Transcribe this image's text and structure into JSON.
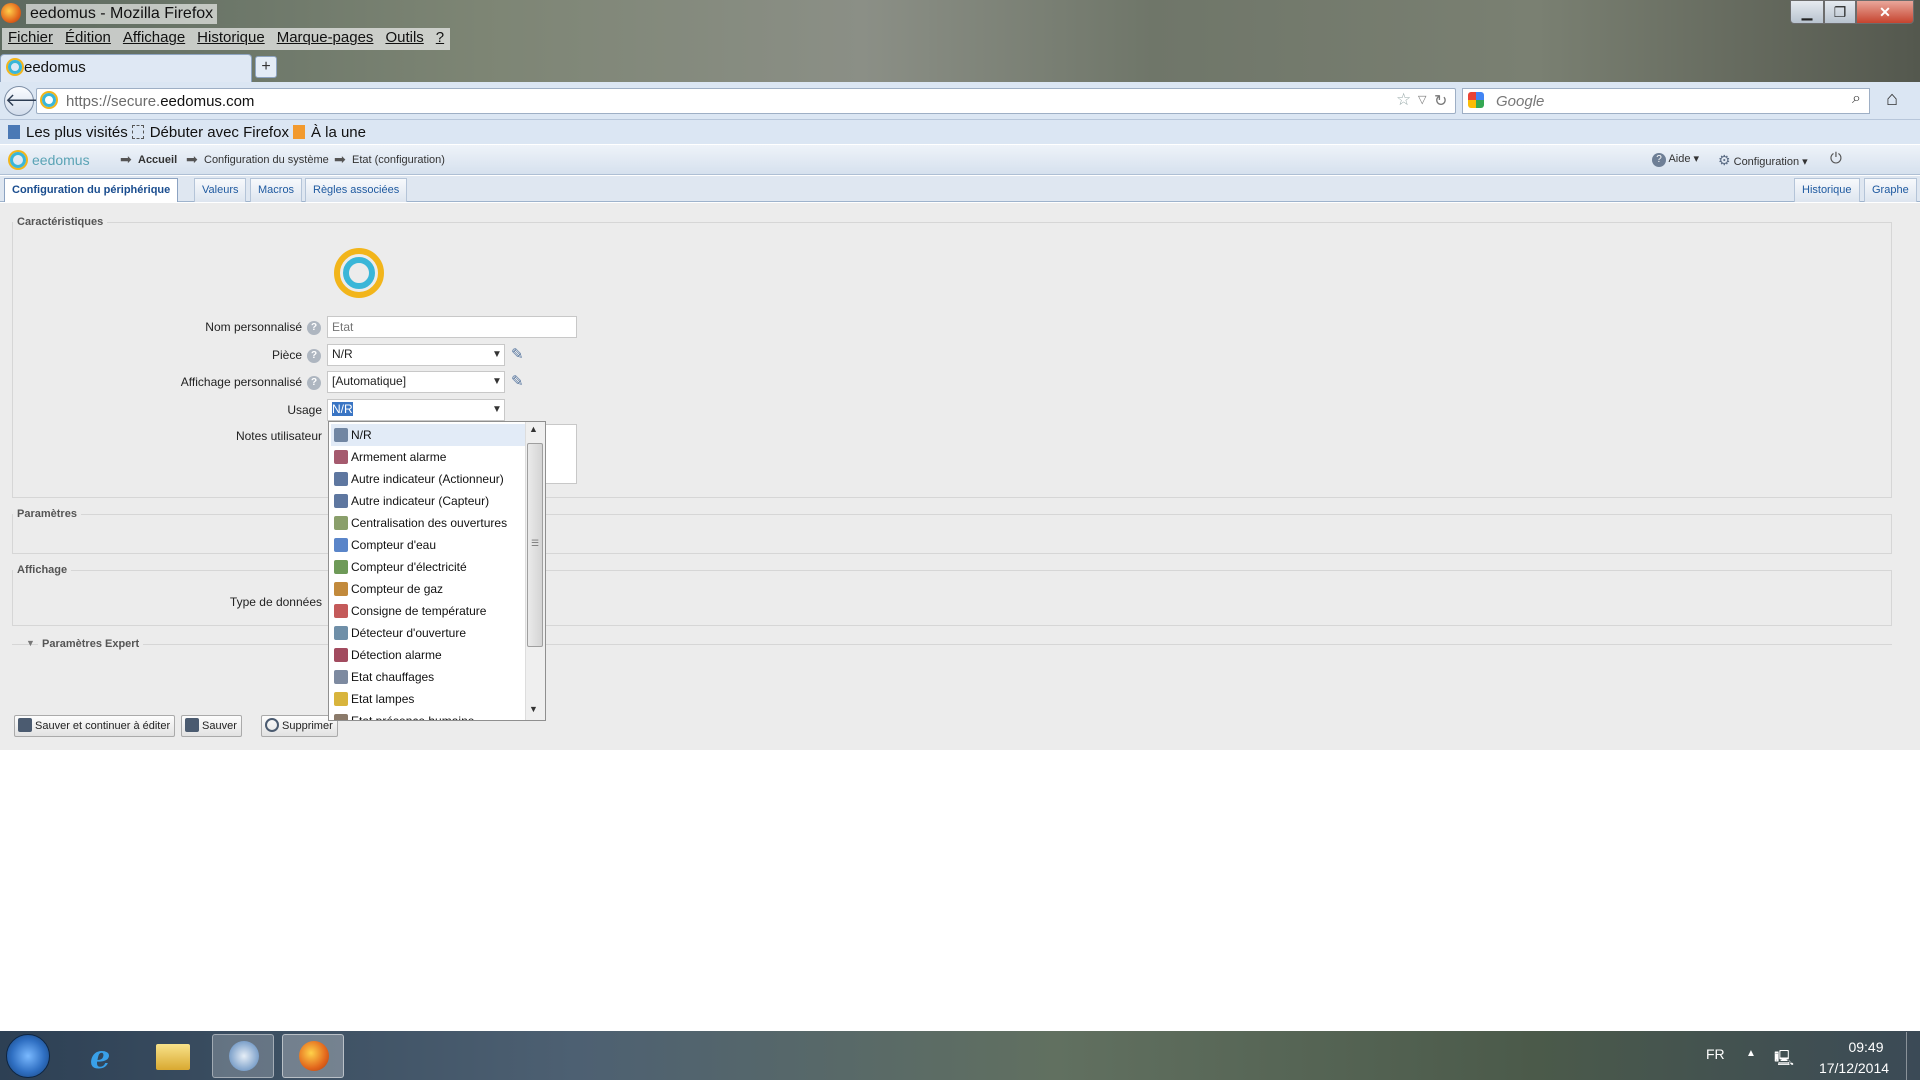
{
  "window": {
    "title": "eedomus - Mozilla Firefox"
  },
  "menubar": [
    "Fichier",
    "Édition",
    "Affichage",
    "Historique",
    "Marque-pages",
    "Outils",
    "?"
  ],
  "browser_tab": {
    "title": "eedomus",
    "new_tab": "+"
  },
  "address": {
    "prefix": "https://secure.",
    "domain": "eedomus.com"
  },
  "search": {
    "placeholder": "Google"
  },
  "bookmarks": [
    "Les plus visités",
    "Débuter avec Firefox",
    "À la une"
  ],
  "app": {
    "logo": "eedomus",
    "breadcrumb": [
      "Accueil",
      "Configuration du système",
      "Etat (configuration)"
    ],
    "help": "Aide",
    "config": "Configuration"
  },
  "tabs": {
    "left": [
      "Configuration du périphérique",
      "Valeurs",
      "Macros",
      "Règles associées"
    ],
    "right": [
      "Historique",
      "Graphe"
    ]
  },
  "sections": {
    "caracteristiques": "Caractéristiques",
    "parametres": "Paramètres",
    "affichage": "Affichage",
    "expert": "Paramètres Expert"
  },
  "form": {
    "nom_label": "Nom personnalisé",
    "nom_placeholder": "Etat",
    "piece_label": "Pièce",
    "piece_value": "N/R",
    "affichage_label": "Affichage personnalisé",
    "affichage_value": "[Automatique]",
    "usage_label": "Usage",
    "usage_value": "N/R",
    "notes_label": "Notes utilisateur",
    "type_label": "Type de données"
  },
  "usage_options": [
    {
      "label": "N/R",
      "icon": "blank-icon",
      "color": "#7186a3"
    },
    {
      "label": "Armement alarme",
      "icon": "alarm-icon",
      "color": "#a55a6e"
    },
    {
      "label": "Autre indicateur (Actionneur)",
      "icon": "indicator-icon",
      "color": "#5e77a0"
    },
    {
      "label": "Autre indicateur (Capteur)",
      "icon": "indicator-icon",
      "color": "#5e77a0"
    },
    {
      "label": "Centralisation des ouvertures",
      "icon": "shutters-icon",
      "color": "#8a9f6b"
    },
    {
      "label": "Compteur d'eau",
      "icon": "water-drop-icon",
      "color": "#5a85c9"
    },
    {
      "label": "Compteur d'électricité",
      "icon": "electricity-icon",
      "color": "#6e9a58"
    },
    {
      "label": "Compteur de gaz",
      "icon": "gas-icon",
      "color": "#c28a3c"
    },
    {
      "label": "Consigne de température",
      "icon": "thermometer-icon",
      "color": "#c45a5a"
    },
    {
      "label": "Détecteur d'ouverture",
      "icon": "door-icon",
      "color": "#6f8fa8"
    },
    {
      "label": "Détection alarme",
      "icon": "alarm-detect-icon",
      "color": "#a24b5f"
    },
    {
      "label": "Etat chauffages",
      "icon": "radiator-icon",
      "color": "#7d8aa0"
    },
    {
      "label": "Etat lampes",
      "icon": "lamp-icon",
      "color": "#d8b43c"
    },
    {
      "label": "Etat présence humaine",
      "icon": "person-icon",
      "color": "#8b7a6a"
    }
  ],
  "buttons": {
    "save_continue": "Sauver et continuer à éditer",
    "save": "Sauver",
    "delete": "Supprimer"
  },
  "taskbar": {
    "lang": "FR",
    "time": "09:49",
    "date": "17/12/2014"
  }
}
